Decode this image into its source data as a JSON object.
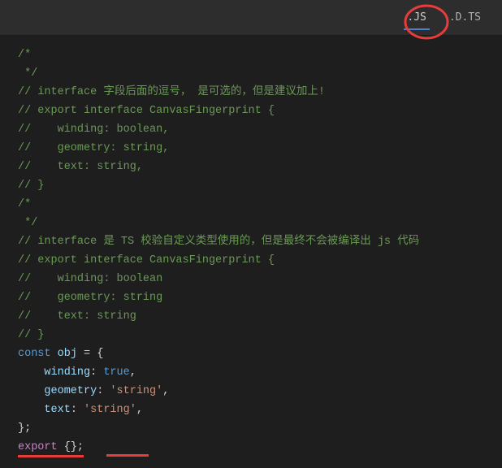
{
  "tabs": {
    "js": ".JS",
    "dts": ".D.TS"
  },
  "code": {
    "l1": "/*",
    "l2": " */",
    "l3": "// interface 字段后面的逗号， 是可选的，但是建议加上!",
    "l4": "// export interface CanvasFingerprint {",
    "l5": "//    winding: boolean,",
    "l6": "//    geometry: string,",
    "l7": "//    text: string,",
    "l8": "// }",
    "l9": "/*",
    "l10": "",
    "l11": " */",
    "l12": "// interface 是 TS 校验自定义类型使用的，但是最终不会被编译出 js 代码",
    "l13": "// export interface CanvasFingerprint {",
    "l14": "//    winding: boolean",
    "l15": "//    geometry: string",
    "l16": "//    text: string",
    "l17": "// }",
    "l18_kw": "const",
    "l18_id": " obj ",
    "l18_eq": "= {",
    "l19_id": "    winding",
    "l19_colon": ": ",
    "l19_val": "true",
    "l19_comma": ",",
    "l20_id": "    geometry",
    "l20_colon": ": ",
    "l20_val": "'string'",
    "l20_comma": ",",
    "l21_id": "    text",
    "l21_colon": ": ",
    "l21_val": "'string'",
    "l21_comma": ",",
    "l22": "};",
    "l23_kw": "export",
    "l23_rest": " {};"
  }
}
